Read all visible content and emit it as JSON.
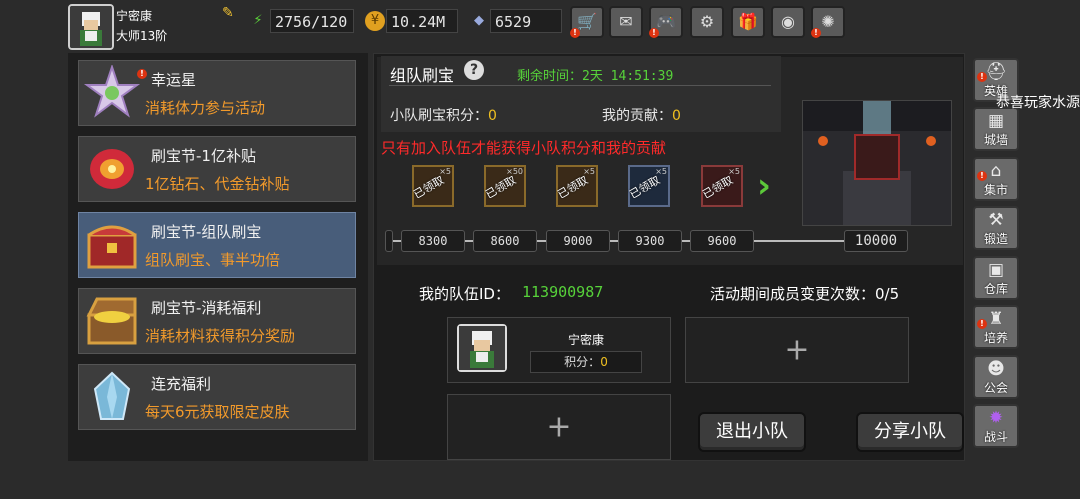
{
  "player": {
    "name": "宁密康",
    "rank": "大师13阶"
  },
  "resources": {
    "stamina": "2756/120",
    "gold": "10.24M",
    "gems": "6529"
  },
  "top_icons": [
    "shop-cart-icon",
    "mail-icon",
    "gamepad-icon",
    "gear-icon",
    "gift-icon",
    "color-wheel-icon",
    "fireworks-icon"
  ],
  "events": [
    {
      "title": "幸运星",
      "desc": "消耗体力参与活动",
      "icon": "lucky-star-icon"
    },
    {
      "title": "刷宝节-1亿补贴",
      "desc": "1亿钻石、代金钻补贴",
      "icon": "red-gem-icon"
    },
    {
      "title": "刷宝节-组队刷宝",
      "desc": "组队刷宝、事半功倍",
      "icon": "treasure-chest-icon",
      "selected": true
    },
    {
      "title": "刷宝节-消耗福利",
      "desc": "消耗材料获得积分奖励",
      "icon": "gold-chest-icon"
    },
    {
      "title": "连充福利",
      "desc": "每天6元获取限定皮肤",
      "icon": "crystal-icon"
    }
  ],
  "main": {
    "title": "组队刷宝",
    "help": "?",
    "timer_label": "剩余时间：",
    "timer_value": "2天 14:51:39",
    "team_score_label": "小队刷宝积分：",
    "team_score": "0",
    "my_contrib_label": "我的贡献：",
    "my_contrib": "0",
    "warning": "只有加入队伍才能获得小队积分和我的贡献",
    "rewards": [
      {
        "count": "×5",
        "stamp": "已领取",
        "style": "gold"
      },
      {
        "count": "×50",
        "stamp": "已领取",
        "style": "gold"
      },
      {
        "count": "×5",
        "stamp": "已领取",
        "style": "gold"
      },
      {
        "count": "×5",
        "stamp": "已领取",
        "style": "blue"
      },
      {
        "count": "×5",
        "stamp": "已领取",
        "style": "red"
      }
    ],
    "milestones": [
      "8300",
      "8600",
      "9000",
      "9300",
      "9600",
      "10000"
    ],
    "progress": 0,
    "team_id_label": "我的队伍ID：",
    "team_id": "113900987",
    "changes_label": "活动期间成员变更次数：",
    "changes_value": "0/5",
    "member": {
      "name": "宁密康",
      "score_label": "积分：",
      "score": "0"
    },
    "plus": "+",
    "leave_label": "退出小队",
    "share_label": "分享小队"
  },
  "side_buttons": [
    {
      "label": "英雄",
      "icon": "hero-helmet-icon"
    },
    {
      "label": "城墙",
      "icon": "castle-wall-icon"
    },
    {
      "label": "集市",
      "icon": "market-icon"
    },
    {
      "label": "锻造",
      "icon": "anvil-icon"
    },
    {
      "label": "仓库",
      "icon": "warehouse-icon"
    },
    {
      "label": "培养",
      "icon": "train-icon"
    },
    {
      "label": "公会",
      "icon": "guild-icon"
    },
    {
      "label": "战斗",
      "icon": "battle-portal-icon"
    }
  ],
  "toast": "恭喜玩家水源"
}
